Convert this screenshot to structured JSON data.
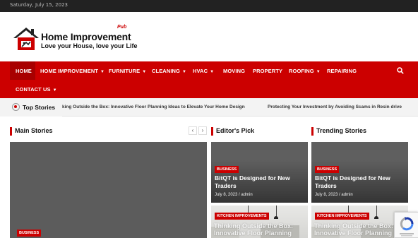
{
  "topbar": {
    "date": "Saturday, July 15, 2023"
  },
  "logo": {
    "title": "Home Improvement",
    "superscript": "Pub",
    "tagline": "Love your House, love your Life"
  },
  "nav": {
    "items": [
      {
        "label": "HOME",
        "dropdown": false
      },
      {
        "label": "HOME IMPROVEMENT",
        "dropdown": true
      },
      {
        "label": "FURNITURE",
        "dropdown": true
      },
      {
        "label": "CLEANING",
        "dropdown": true
      },
      {
        "label": "HVAC",
        "dropdown": true
      },
      {
        "label": "MOVING",
        "dropdown": false
      },
      {
        "label": "PROPERTY",
        "dropdown": false
      },
      {
        "label": "ROOFING",
        "dropdown": true
      },
      {
        "label": "REPAIRING",
        "dropdown": false
      },
      {
        "label": "CONTACT US",
        "dropdown": true
      }
    ],
    "search_icon": "search-icon",
    "caret_glyph": "▼"
  },
  "ticker": {
    "label": "Top Stories",
    "items": [
      "king Outside the Box: Innovative Floor Planning Ideas to Elevate Your Home Design",
      "Protecting Your Investment by Avoiding Scams in Resin drive"
    ]
  },
  "sections": {
    "main": "Main Stories",
    "editors": "Editor's Pick",
    "trending": "Trending Stories"
  },
  "slider": {
    "prev": "‹",
    "next": "›"
  },
  "main_story": {
    "badge": "BUSINESS"
  },
  "editors_pick": [
    {
      "badge": "BUSINESS",
      "title": "BitQT is Designed for New Traders",
      "date": "July 8, 2023",
      "author": "admin",
      "meta": "July 8, 2023 / admin"
    },
    {
      "badge": "KITCHEN IMPROVEMENTS",
      "title": "Thinking Outside the Box: Innovative Floor Planning"
    }
  ],
  "trending": [
    {
      "badge": "BUSINESS",
      "title": "BitQT is Designed for New Traders",
      "date": "July 8, 2023",
      "author": "admin",
      "meta": "July 8, 2023 / admin"
    },
    {
      "badge": "KITCHEN IMPROVEMENTS",
      "title": "Thinking Outside the Box: Innovative Floor Planning"
    }
  ],
  "colors": {
    "accent": "#cc0000",
    "topbar": "#222222",
    "card": "#5f5f5f"
  }
}
